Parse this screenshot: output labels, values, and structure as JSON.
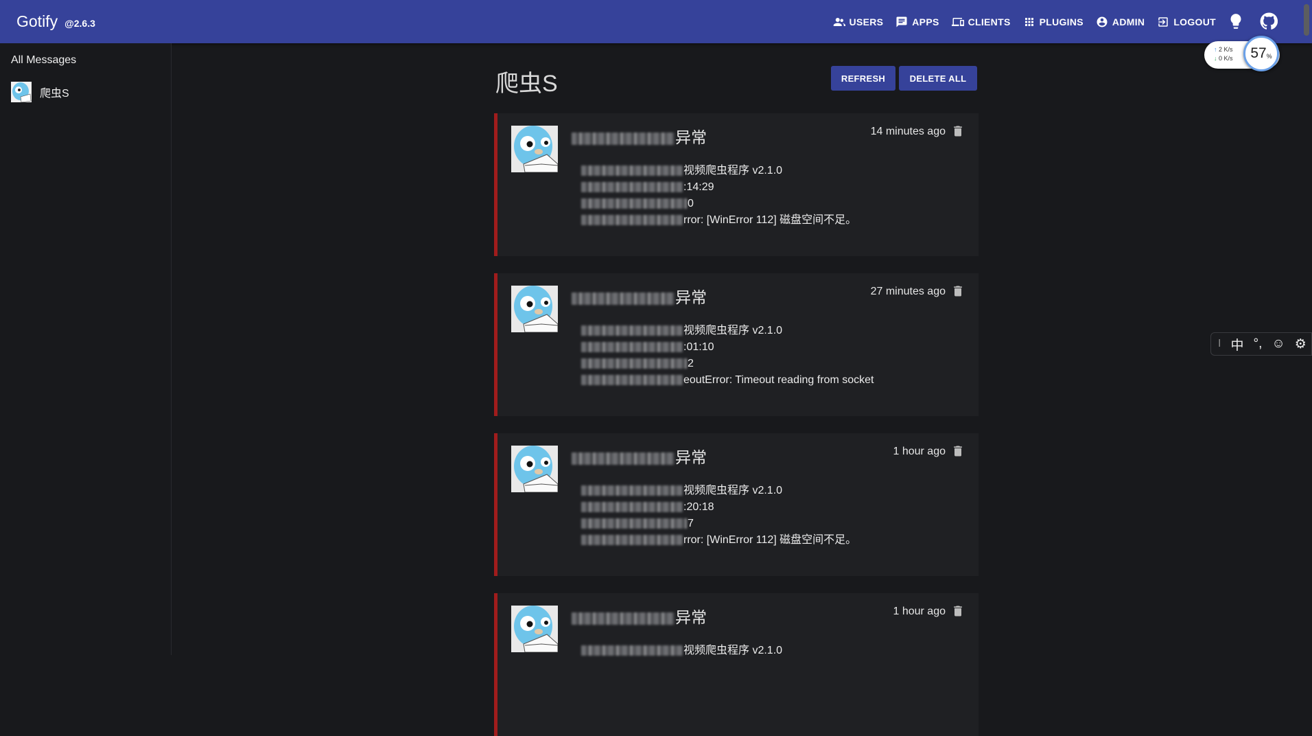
{
  "app": {
    "name": "Gotify",
    "version": "@2.6.3"
  },
  "nav": [
    {
      "label": "USERS",
      "icon": "users-icon"
    },
    {
      "label": "APPS",
      "icon": "chat-icon"
    },
    {
      "label": "CLIENTS",
      "icon": "devices-icon"
    },
    {
      "label": "PLUGINS",
      "icon": "apps-grid-icon"
    },
    {
      "label": "ADMIN",
      "icon": "account-icon"
    },
    {
      "label": "LOGOUT",
      "icon": "logout-icon"
    }
  ],
  "sidebar": {
    "all_messages": "All Messages",
    "apps": [
      {
        "name": "爬虫S"
      }
    ]
  },
  "page": {
    "title": "爬虫S",
    "refresh_label": "REFRESH",
    "delete_all_label": "DELETE ALL"
  },
  "messages": [
    {
      "title_suffix": "异常",
      "time": "14 minutes ago",
      "lines": [
        "视频爬虫程序 v2.1.0",
        ":14:29",
        "0",
        "rror: [WinError 112] 磁盘空间不足。"
      ]
    },
    {
      "title_suffix": "异常",
      "time": "27 minutes ago",
      "lines": [
        "视频爬虫程序 v2.1.0",
        ":01:10",
        "2",
        "eoutError: Timeout reading from socket"
      ]
    },
    {
      "title_suffix": "异常",
      "time": "1 hour ago",
      "lines": [
        "视频爬虫程序 v2.1.0",
        ":20:18",
        "7",
        "rror: [WinError 112] 磁盘空间不足。"
      ]
    },
    {
      "title_suffix": "异常",
      "time": "1 hour ago",
      "lines": [
        "视频爬虫程序 v2.1.0"
      ]
    }
  ],
  "net_speed": {
    "up": "2  K/s",
    "down": "0  K/s"
  },
  "gauge": {
    "value": "57",
    "unit": "%"
  },
  "ime": {
    "cursor": "I",
    "lang": "中",
    "punct": "°,",
    "emoji": "☺",
    "settings": "⚙"
  },
  "colors": {
    "appbar": "#36429a",
    "accent_bar": "#a01c1c",
    "background": "#18191c",
    "card": "#1f2023"
  }
}
